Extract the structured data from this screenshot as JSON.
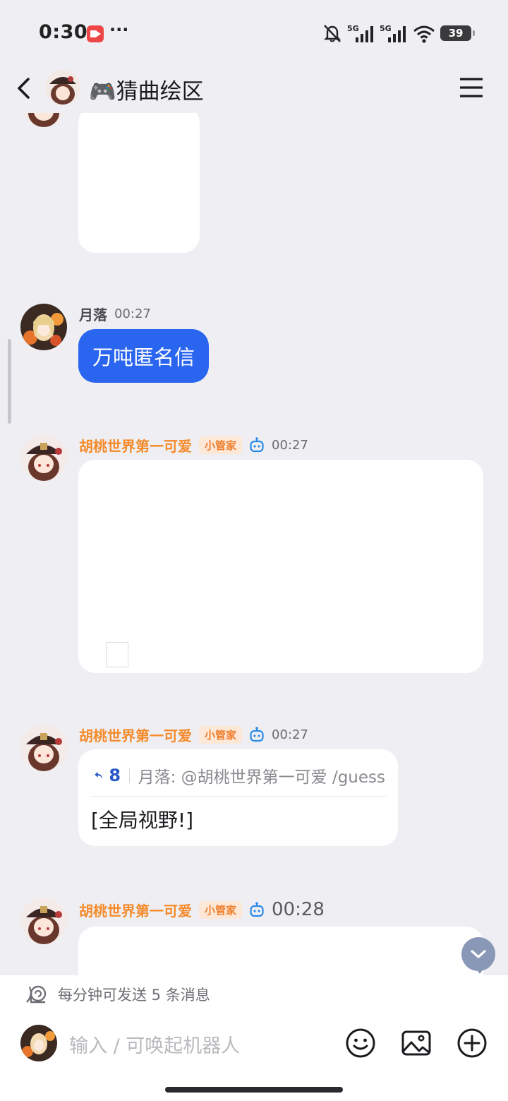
{
  "status_bar": {
    "time": "0:30",
    "more": "···",
    "battery": "39"
  },
  "header": {
    "group_name": "🎮猜曲绘区"
  },
  "messages": [
    {
      "type": "image",
      "note": ""
    },
    {
      "type": "text",
      "sender": "月落",
      "time": "00:27",
      "text": "万吨匿名信"
    },
    {
      "type": "image",
      "sender": "胡桃世界第一可爱",
      "badge": "小管家",
      "time": "00:27"
    },
    {
      "type": "reply",
      "sender": "胡桃世界第一可爱",
      "badge": "小管家",
      "time": "00:27",
      "reply_count": "8",
      "quote": "月落: @胡桃世界第一可爱 /guess",
      "text": "[全局视野!]"
    },
    {
      "type": "image",
      "sender": "胡桃世界第一可爱",
      "badge": "小管家",
      "time": "00:28"
    }
  ],
  "composer": {
    "rate_limit": "每分钟可发送 5 条消息",
    "placeholder": "输入 / 可唤起机器人"
  },
  "colors": {
    "accent_blue": "#2a65ef",
    "name_orange": "#f58a2a",
    "badge_bg": "#fde8d8"
  }
}
